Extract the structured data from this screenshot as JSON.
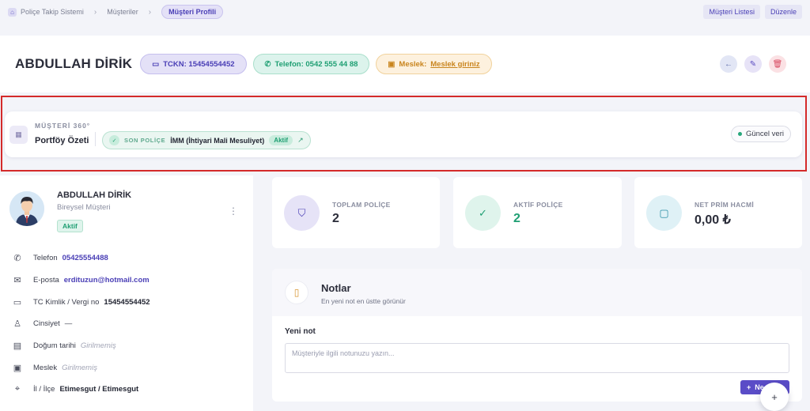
{
  "breadcrumb": {
    "items": [
      "Poliçe Takip Sistemi",
      "Müşteriler"
    ],
    "active": "Müşteri Profili"
  },
  "top_actions": {
    "list": "Müşteri Listesi",
    "edit": "Düzenle"
  },
  "header": {
    "name": "ABDULLAH DİRİK",
    "id_pill": "TCKN: 15454554452",
    "phone_pill": "Telefon: 0542 555 44 88",
    "job_label": "Meslek:",
    "job_link": "Meslek giriniz"
  },
  "portfolio": {
    "eyebrow": "MÜŞTERİ 360°",
    "title": "Portföy Özeti",
    "chip_label": "SON POLİÇE",
    "chip_value": "İMM (İhtiyari Mali Mesuliyet)",
    "chip_badge": "Aktif",
    "fresh": "Güncel veri"
  },
  "profile": {
    "name": "ABDULLAH DİRİK",
    "type": "Bireysel Müşteri",
    "status": "Aktif",
    "rows": [
      {
        "icon": "phone-icon",
        "label": "Telefon",
        "value": "05425554488",
        "style": "link"
      },
      {
        "icon": "mail-icon",
        "label": "E-posta",
        "value": "erdituzun@hotmail.com",
        "style": "link"
      },
      {
        "icon": "id-card-icon",
        "label": "TC Kimlik / Vergi no",
        "value": "15454554452",
        "style": "bold"
      },
      {
        "icon": "user-icon",
        "label": "Cinsiyet",
        "value": "—",
        "style": "plain"
      },
      {
        "icon": "calendar-icon",
        "label": "Doğum tarihi",
        "value": "Girilmemiş",
        "style": "muted"
      },
      {
        "icon": "briefcase-icon",
        "label": "Meslek",
        "value": "Girilmemiş",
        "style": "muted"
      },
      {
        "icon": "location-pin-icon",
        "label": "İl / İlçe",
        "value": "Etimesgut / Etimesgut",
        "style": "bold"
      }
    ]
  },
  "stats": [
    {
      "label": "TOPLAM POLİÇE",
      "value": "2",
      "icon": "shield-icon",
      "color": "#4a3fb6"
    },
    {
      "label": "AKTİF POLİÇE",
      "value": "2",
      "icon": "check-circle-icon",
      "color": "#1f9f73"
    },
    {
      "label": "NET PRİM HACMİ",
      "value": "0,00 ₺",
      "icon": "wallet-icon",
      "color": "#2b2d3a"
    }
  ],
  "notes": {
    "title": "Notlar",
    "subtitle": "En yeni not en üstte görünür",
    "new_label": "Yeni not",
    "placeholder": "Müşteriyle ilgili notunuzu yazın...",
    "add_button": "Ne"
  },
  "colors": {
    "accent": "#5a4cc7",
    "success": "#1f9f73",
    "warning": "#c9851e",
    "danger": "#d8485f"
  }
}
